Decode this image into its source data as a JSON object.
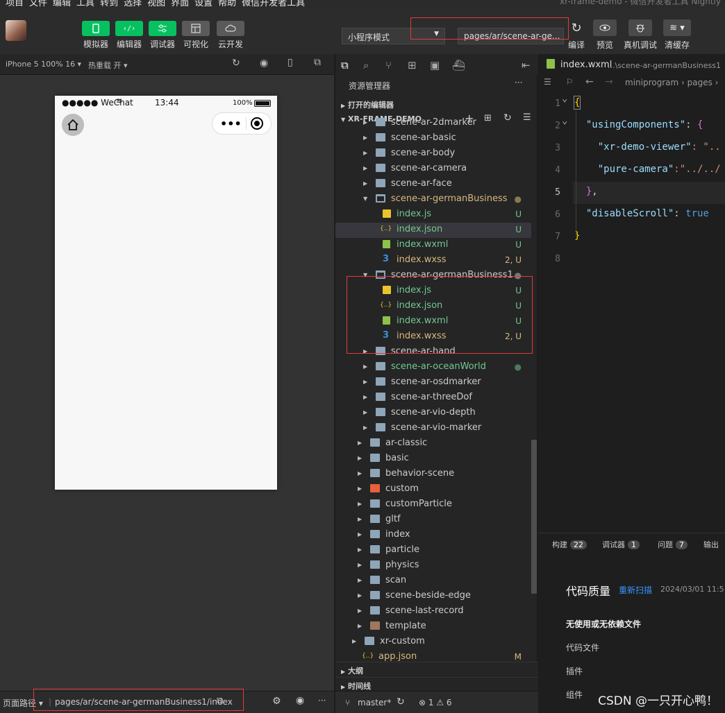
{
  "menubar": {
    "items": [
      "项目",
      "文件",
      "编辑",
      "工具",
      "转到",
      "选择",
      "视图",
      "界面",
      "设置",
      "帮助",
      "微信开发者工具"
    ],
    "window_title": "xr-frame-demo - 微信开发者工具 Nightly"
  },
  "toolbar": {
    "left_buttons": [
      {
        "label": "模拟器",
        "icon": "phone-icon"
      },
      {
        "label": "编辑器",
        "icon": "code-icon"
      },
      {
        "label": "调试器",
        "icon": "debug-icon"
      },
      {
        "label": "可视化",
        "icon": "layout-icon"
      },
      {
        "label": "云开发",
        "icon": "cloud-icon"
      }
    ],
    "mode_select": "小程序模式",
    "page_select": "pages/ar/scene-ar-ge...",
    "right_buttons": [
      {
        "label": "编译",
        "icon": "refresh-icon"
      },
      {
        "label": "预览",
        "icon": "eye-icon"
      },
      {
        "label": "真机调试",
        "icon": "bug-icon"
      },
      {
        "label": "清缓存",
        "icon": "layers-icon"
      }
    ]
  },
  "simulator": {
    "device": "iPhone 5 100% 16 ▾",
    "hot_reload": "热重载 开 ▾",
    "status": {
      "carrier": "●●●●● WeChat",
      "time": "13:44",
      "battery": "100%"
    },
    "capsule_dots": "•••"
  },
  "bottombar": {
    "path_label": "页面路径 ▾",
    "path": "pages/ar/scene-ar-germanBusiness1/index",
    "branch": "master*",
    "problems": "⊗ 1 ⚠ 6"
  },
  "explorer": {
    "title": "资源管理器",
    "more": "···",
    "open_editors": "打开的编辑器",
    "project": "XR-FRAME-DEMO",
    "outline": "大纲",
    "timeline": "时间线",
    "tree": [
      {
        "name": "scene-ar-2dmarker",
        "type": "folder",
        "indent": 2,
        "color": "#ccc"
      },
      {
        "name": "scene-ar-basic",
        "type": "folder",
        "indent": 2,
        "color": "#ccc"
      },
      {
        "name": "scene-ar-body",
        "type": "folder",
        "indent": 2,
        "color": "#ccc"
      },
      {
        "name": "scene-ar-camera",
        "type": "folder",
        "indent": 2,
        "color": "#ccc"
      },
      {
        "name": "scene-ar-face",
        "type": "folder",
        "indent": 2,
        "color": "#ccc"
      },
      {
        "name": "scene-ar-germanBusiness",
        "type": "folder-open",
        "indent": 2,
        "color": "#d7ba7d",
        "badge": "●",
        "badge_color": "#8a7a50"
      },
      {
        "name": "index.js",
        "type": "js",
        "indent": 3,
        "color": "#73c991",
        "badge": "U",
        "badge_color": "#73c991"
      },
      {
        "name": "index.json",
        "type": "json",
        "indent": 3,
        "color": "#73c991",
        "badge": "U",
        "badge_color": "#73c991",
        "selected": true
      },
      {
        "name": "index.wxml",
        "type": "wxml",
        "indent": 3,
        "color": "#73c991",
        "badge": "U",
        "badge_color": "#73c991"
      },
      {
        "name": "index.wxss",
        "type": "wxss",
        "indent": 3,
        "color": "#d7ba7d",
        "badge": "2, U",
        "badge_color": "#d7ba7d"
      },
      {
        "name": "scene-ar-germanBusiness1",
        "type": "folder-open",
        "indent": 2,
        "color": "#ccc",
        "badge": "●",
        "badge_color": "#777"
      },
      {
        "name": "index.js",
        "type": "js",
        "indent": 3,
        "color": "#73c991",
        "badge": "U",
        "badge_color": "#73c991"
      },
      {
        "name": "index.json",
        "type": "json",
        "indent": 3,
        "color": "#73c991",
        "badge": "U",
        "badge_color": "#73c991"
      },
      {
        "name": "index.wxml",
        "type": "wxml",
        "indent": 3,
        "color": "#73c991",
        "badge": "U",
        "badge_color": "#73c991"
      },
      {
        "name": "index.wxss",
        "type": "wxss",
        "indent": 3,
        "color": "#d7ba7d",
        "badge": "2, U",
        "badge_color": "#d7ba7d"
      },
      {
        "name": "scene-ar-hand",
        "type": "folder",
        "indent": 2,
        "color": "#ccc"
      },
      {
        "name": "scene-ar-oceanWorld",
        "type": "folder",
        "indent": 2,
        "color": "#73c991",
        "badge": "●",
        "badge_color": "#4d7a5a"
      },
      {
        "name": "scene-ar-osdmarker",
        "type": "folder",
        "indent": 2,
        "color": "#ccc"
      },
      {
        "name": "scene-ar-threeDof",
        "type": "folder",
        "indent": 2,
        "color": "#ccc"
      },
      {
        "name": "scene-ar-vio-depth",
        "type": "folder",
        "indent": 2,
        "color": "#ccc"
      },
      {
        "name": "scene-ar-vio-marker",
        "type": "folder",
        "indent": 2,
        "color": "#ccc"
      },
      {
        "name": "ar-classic",
        "type": "folder",
        "indent": 1,
        "color": "#ccc"
      },
      {
        "name": "basic",
        "type": "folder",
        "indent": 1,
        "color": "#ccc"
      },
      {
        "name": "behavior-scene",
        "type": "folder",
        "indent": 1,
        "color": "#ccc"
      },
      {
        "name": "custom",
        "type": "folder-special",
        "indent": 1,
        "color": "#ccc"
      },
      {
        "name": "customParticle",
        "type": "folder",
        "indent": 1,
        "color": "#ccc"
      },
      {
        "name": "gltf",
        "type": "folder",
        "indent": 1,
        "color": "#ccc"
      },
      {
        "name": "index",
        "type": "folder",
        "indent": 1,
        "color": "#ccc"
      },
      {
        "name": "particle",
        "type": "folder",
        "indent": 1,
        "color": "#ccc"
      },
      {
        "name": "physics",
        "type": "folder",
        "indent": 1,
        "color": "#ccc"
      },
      {
        "name": "scan",
        "type": "folder",
        "indent": 1,
        "color": "#ccc"
      },
      {
        "name": "scene-beside-edge",
        "type": "folder",
        "indent": 1,
        "color": "#ccc"
      },
      {
        "name": "scene-last-record",
        "type": "folder",
        "indent": 1,
        "color": "#ccc"
      },
      {
        "name": "template",
        "type": "folder-template",
        "indent": 1,
        "color": "#ccc"
      },
      {
        "name": "xr-custom",
        "type": "folder",
        "indent": 0,
        "color": "#ccc"
      },
      {
        "name": "app.json",
        "type": "json",
        "indent": 0,
        "color": "#d7ba7d",
        "badge": "M",
        "badge_color": "#d7ba7d"
      }
    ]
  },
  "editor": {
    "tab": "index.wxml",
    "tab_path": "...\\scene-ar-germanBusiness1",
    "breadcrumb": "miniprogram › pages ›",
    "lines": [
      {
        "n": "1",
        "parts": [
          [
            "{",
            "br2"
          ]
        ]
      },
      {
        "n": "2",
        "parts": [
          [
            "  \"usingComponents\"",
            "key"
          ],
          [
            ": ",
            "pn"
          ],
          [
            "{",
            "br"
          ]
        ]
      },
      {
        "n": "3",
        "parts": [
          [
            "    \"xr-demo-viewer\"",
            "key"
          ],
          [
            ": \"..",
            "str"
          ]
        ]
      },
      {
        "n": "4",
        "parts": [
          [
            "    \"pure-camera\"",
            "key"
          ],
          [
            ":\"../../",
            "str"
          ]
        ]
      },
      {
        "n": "5",
        "parts": [
          [
            "  }",
            "br"
          ],
          [
            ",",
            "pn"
          ]
        ]
      },
      {
        "n": "6",
        "parts": [
          [
            "  \"disableScroll\"",
            "key"
          ],
          [
            ": ",
            "pn"
          ],
          [
            "true",
            "kw"
          ]
        ]
      },
      {
        "n": "7",
        "parts": [
          [
            "}",
            "br2"
          ]
        ]
      },
      {
        "n": "8",
        "parts": []
      }
    ]
  },
  "panel": {
    "tabs": [
      {
        "label": "构建",
        "count": "22"
      },
      {
        "label": "调试器",
        "count": "1"
      },
      {
        "label": "问题",
        "count": "7"
      },
      {
        "label": "输出",
        "count": ""
      }
    ],
    "title": "代码质量",
    "rescan": "重新扫描",
    "date": "2024/03/01 11:5",
    "section": "无使用或无依赖文件",
    "items": [
      "代码文件",
      "插件",
      "组件"
    ]
  },
  "watermark": "CSDN @一只开心鸭！"
}
